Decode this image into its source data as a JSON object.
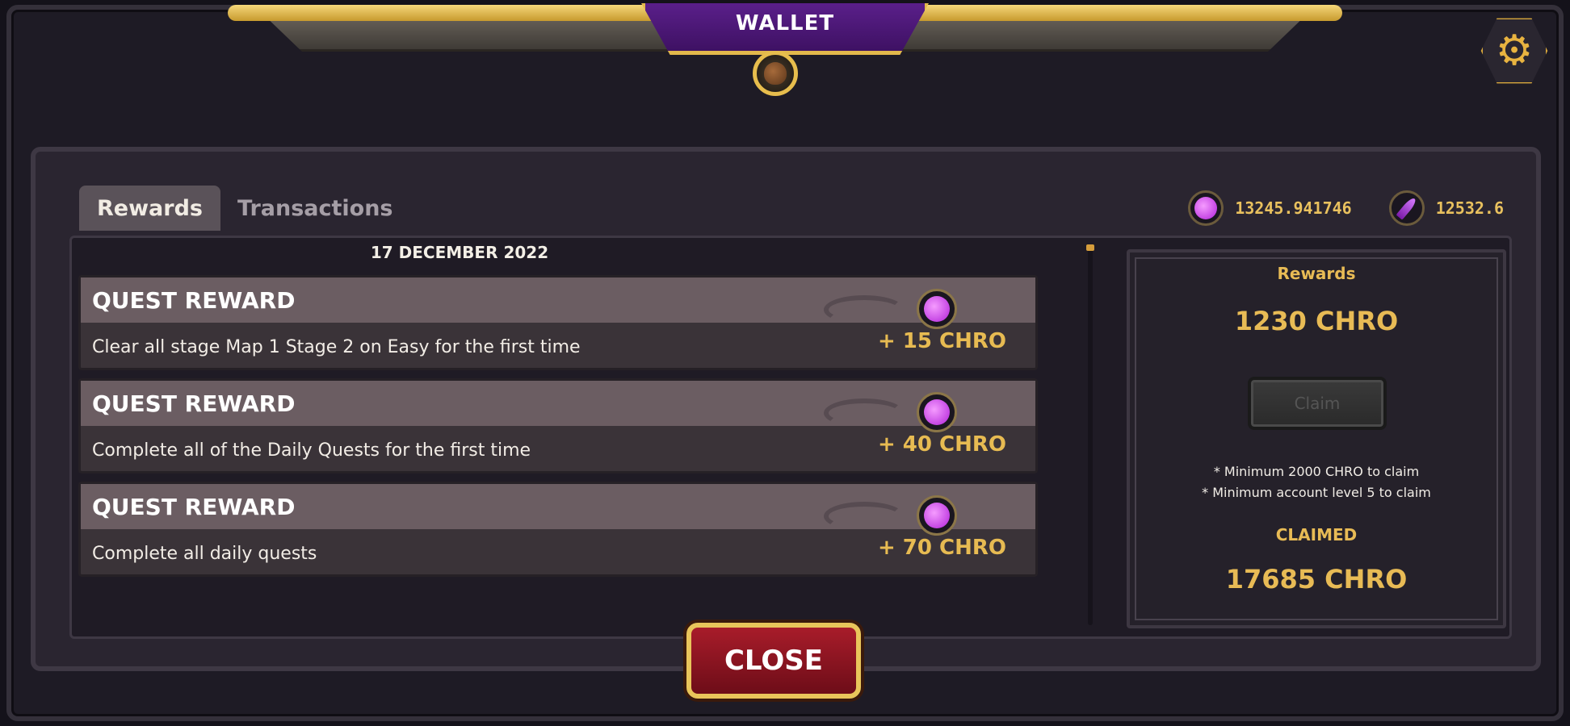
{
  "header": {
    "title": "WALLET"
  },
  "tabs": [
    {
      "label": "Rewards",
      "active": true
    },
    {
      "label": "Transactions",
      "active": false
    }
  ],
  "balances": {
    "chro": "13245.941746",
    "feather": "12532.6"
  },
  "list": {
    "date": "17 DECEMBER 2022",
    "quests": [
      {
        "title": "QUEST REWARD",
        "description": "Clear all stage Map 1 Stage 2 on Easy for the first time",
        "amount": "+ 15 CHRO"
      },
      {
        "title": "QUEST REWARD",
        "description": "Complete all of the Daily Quests for the first time",
        "amount": "+ 40 CHRO"
      },
      {
        "title": "QUEST REWARD",
        "description": "Complete all daily quests",
        "amount": "+ 70 CHRO"
      }
    ]
  },
  "side": {
    "rewards_label": "Rewards",
    "rewards_value": "1230 CHRO",
    "claim_label": "Claim",
    "note_1": "* Minimum 2000 CHRO to claim",
    "note_2": "* Minimum account level 5 to claim",
    "claimed_label": "CLAIMED",
    "claimed_value": "17685 CHRO"
  },
  "footer": {
    "close_label": "CLOSE"
  },
  "colors": {
    "accent_gold": "#e8bb55",
    "brand_purple": "#5a1f8a",
    "close_red": "#a81c2a"
  },
  "icons": {
    "settings": "gear-icon",
    "wallet": "money-bag-icon",
    "currency": "chro-coin-icon",
    "feather": "feather-icon"
  }
}
